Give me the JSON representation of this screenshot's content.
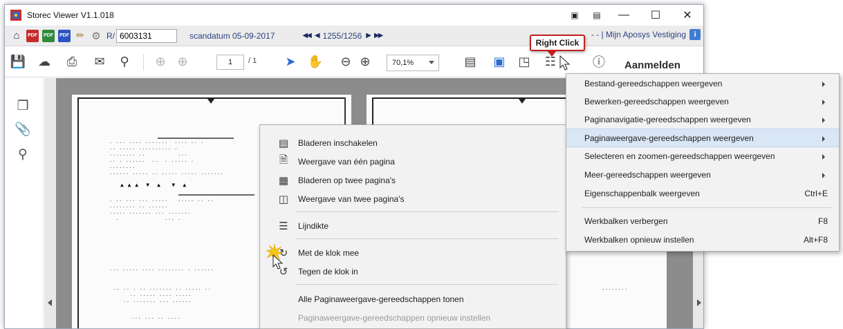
{
  "window": {
    "title": "Storec Viewer V1.1.018"
  },
  "storec_bar": {
    "r_label": "R/",
    "r_value": "6003131",
    "scan_date": "scandatum 05-09-2017",
    "page_position": "1255/1256",
    "vestiging": "- - | Mijn Aposys Vestiging"
  },
  "pdf_toolbar": {
    "page_current": "1",
    "page_total": "/ 1",
    "zoom": "70,1%",
    "aanmelden": "Aanmelden"
  },
  "callout": {
    "text": "Right Click"
  },
  "context_menu_main": {
    "items": [
      {
        "label": "Bladeren inschakelen",
        "icon": "browse-icon"
      },
      {
        "label": "Weergave van één pagina",
        "icon": "single-page-icon"
      },
      {
        "label": "Bladeren op twee pagina's",
        "icon": "two-page-browse-icon"
      },
      {
        "label": "Weergave van twee pagina's",
        "icon": "two-page-icon"
      },
      {
        "label": "Lijndikte",
        "icon": "line-weight-icon"
      },
      {
        "label": "Met de klok mee",
        "icon": "rotate-clockwise-icon"
      },
      {
        "label": "Tegen de klok in",
        "icon": "rotate-counterclockwise-icon"
      },
      {
        "label": "Alle Paginaweergave-gereedschappen tonen"
      },
      {
        "label": "Paginaweergave-gereedschappen opnieuw instellen"
      }
    ]
  },
  "context_menu_sub": {
    "items": [
      {
        "label": "Bestand-gereedschappen weergeven"
      },
      {
        "label": "Bewerken-gereedschappen weergeven"
      },
      {
        "label": "Paginanavigatie-gereedschappen weergeven"
      },
      {
        "label": "Paginaweergave-gereedschappen weergeven"
      },
      {
        "label": "Selecteren en zoomen-gereedschappen weergeven"
      },
      {
        "label": "Meer-gereedschappen weergeven"
      },
      {
        "label": "Eigenschappenbalk weergeven",
        "shortcut": "Ctrl+E"
      },
      {
        "label": "Werkbalken verbergen",
        "shortcut": "F8"
      },
      {
        "label": "Werkbalken opnieuw instellen",
        "shortcut": "Alt+F8"
      }
    ]
  },
  "colors": {
    "accent": "#2a6bd1",
    "callout_border": "#c21f1f",
    "highlight": "#d9e6f5"
  }
}
